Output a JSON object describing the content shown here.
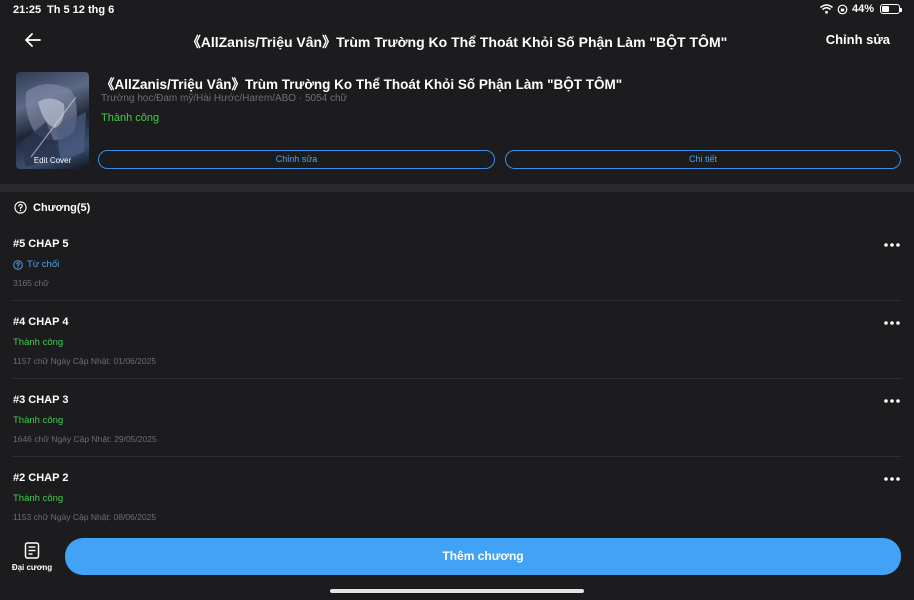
{
  "status_bar": {
    "time": "21:25",
    "date": "Th 5 12 thg 6",
    "battery": "44%",
    "battery_level": 0.44
  },
  "nav": {
    "title": "《AllZanis/Triệu Vân》Trùm Trường Ko Thể Thoát Khỏi Số Phận Làm \"BỘT TÔM\"",
    "edit_label": "Chỉnh sửa"
  },
  "story": {
    "cover_label": "Edit Cover",
    "title": "《AllZanis/Triệu Vân》Trùm Trường Ko Thể Thoát Khỏi Số Phận Làm \"BỘT TÔM\"",
    "meta": "Trường học/Đam mỹ/Hài Hước/Harem/ABO · 5054 chữ",
    "status": "Thành công",
    "edit_button": "Chỉnh sửa",
    "detail_button": "Chi tiết"
  },
  "chapters": {
    "header": "Chương(5)",
    "items": [
      {
        "title": "#5 CHAP 5",
        "status": "Từ chối",
        "status_type": "rejected",
        "meta": "3165 chữ"
      },
      {
        "title": "#4 CHAP 4",
        "status": "Thành công",
        "status_type": "ok",
        "meta": "1157 chữ Ngày Cập Nhật: 01/06/2025"
      },
      {
        "title": "#3 CHAP 3",
        "status": "Thành công",
        "status_type": "ok",
        "meta": "1646 chữ Ngày Cập Nhật: 29/05/2025"
      },
      {
        "title": "#2 CHAP 2",
        "status": "Thành công",
        "status_type": "ok",
        "meta": "1153 chữ Ngày Cập Nhật: 08/06/2025"
      }
    ]
  },
  "bottom": {
    "outline_label": "Đại cương",
    "add_button": "Thêm chương"
  },
  "colors": {
    "background": "#1c1c1e",
    "accent": "#42a2f5",
    "success": "#3fcf4e"
  }
}
